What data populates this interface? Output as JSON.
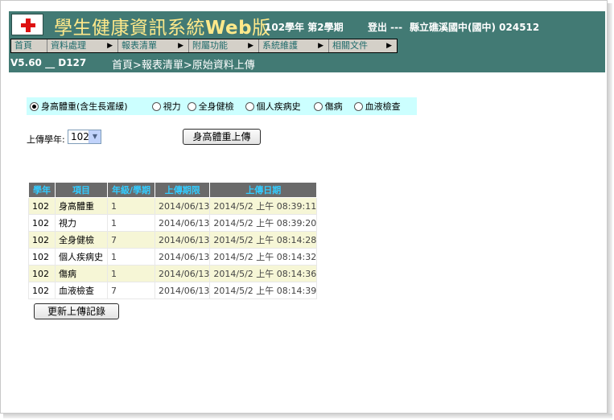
{
  "header": {
    "title_cjk": "學生健康資訊系統",
    "title_web": "Web",
    "title_suffix": "版",
    "semester": "102學年 第2學期",
    "logout": "登出 ---",
    "school": "縣立礁溪國中(國中) 024512",
    "version": "V5.60 __ D127",
    "breadcrumb": "首頁>報表清單>原始資料上傳"
  },
  "menu": [
    {
      "label": "首頁",
      "has_arrow": false
    },
    {
      "label": "資料處理",
      "has_arrow": true
    },
    {
      "label": "報表清單",
      "has_arrow": true
    },
    {
      "label": "附屬功能",
      "has_arrow": true
    },
    {
      "label": "系統維護",
      "has_arrow": true
    },
    {
      "label": "相關文件",
      "has_arrow": true
    }
  ],
  "radio_options": [
    {
      "label": "身高體重(含生長遲緩)",
      "selected": true
    },
    {
      "label": "視力",
      "selected": false
    },
    {
      "label": "全身健檢",
      "selected": false
    },
    {
      "label": "個人疾病史",
      "selected": false
    },
    {
      "label": "傷病",
      "selected": false
    },
    {
      "label": "血液檢查",
      "selected": false
    }
  ],
  "upload": {
    "year_label": "上傳學年:",
    "year_value": "102",
    "upload_button": "身高體重上傳"
  },
  "table": {
    "headers": [
      "學年",
      "項目",
      "年級/學期",
      "上傳期限",
      "上傳日期"
    ],
    "rows": [
      [
        "102",
        "身高體重",
        "1",
        "2014/06/13",
        "2014/5/2 上午 08:39:11"
      ],
      [
        "102",
        "視力",
        "1",
        "2014/06/13",
        "2014/5/2 上午 08:39:20"
      ],
      [
        "102",
        "全身健檢",
        "7",
        "2014/06/13",
        "2014/5/2 上午 08:14:28"
      ],
      [
        "102",
        "個人疾病史",
        "1",
        "2014/06/13",
        "2014/5/2 上午 08:14:32"
      ],
      [
        "102",
        "傷病",
        "1",
        "2014/06/13",
        "2014/5/2 上午 08:14:36"
      ],
      [
        "102",
        "血液檢查",
        "7",
        "2014/06/13",
        "2014/5/2 上午 08:14:39"
      ]
    ]
  },
  "refresh_button": "更新上傳記錄",
  "colors": {
    "header_bg": "#427a74",
    "title_text": "#ffe98a",
    "option_bar_bg": "#ccffff",
    "table_header_bg": "#6a6a6a",
    "table_header_text": "#33ccff",
    "row_alt_bg": "#f6f6d6"
  }
}
